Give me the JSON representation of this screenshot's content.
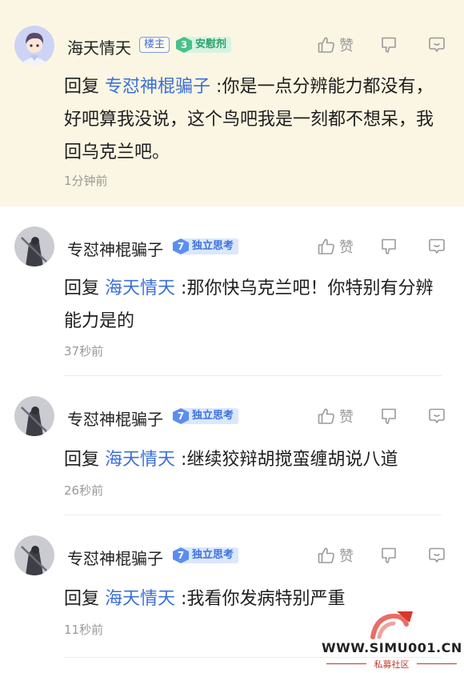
{
  "comments": [
    {
      "username": "海天情天",
      "owner_badge": "楼主",
      "level": "3",
      "level_title": "安慰剂",
      "like_label": "赞",
      "reply_prefix": "回复",
      "reply_target": "专怼神棍骗子",
      "text": ":你是一点分辨能力都没有，好吧算我没说，这个鸟吧我是一刻都不想呆，我回乌克兰吧。",
      "time": "1分钟前"
    },
    {
      "username": "专怼神棍骗子",
      "level": "7",
      "level_title": "独立思考",
      "like_label": "赞",
      "reply_prefix": "回复",
      "reply_target": "海天情天",
      "text": ":那你快乌克兰吧！你特别有分辨能力是的",
      "time": "37秒前"
    },
    {
      "username": "专怼神棍骗子",
      "level": "7",
      "level_title": "独立思考",
      "like_label": "赞",
      "reply_prefix": "回复",
      "reply_target": "海天情天",
      "text": ":继续狡辩胡搅蛮缠胡说八道",
      "time": "26秒前"
    },
    {
      "username": "专怼神棍骗子",
      "level": "7",
      "level_title": "独立思考",
      "like_label": "赞",
      "reply_prefix": "回复",
      "reply_target": "海天情天",
      "text": ":我看你发病特别严重",
      "time": "11秒前"
    }
  ],
  "watermark": {
    "url": "WWW.SIMU001.CN",
    "subtitle": "私募社区"
  },
  "icons": {
    "like": "thumb-up-icon",
    "dislike": "thumb-down-icon",
    "reply": "comment-bubble-icon"
  },
  "colors": {
    "link": "#3a6fd8",
    "highlight_bg": "#fbf6e3",
    "icon_gray": "#9a9a9a"
  }
}
